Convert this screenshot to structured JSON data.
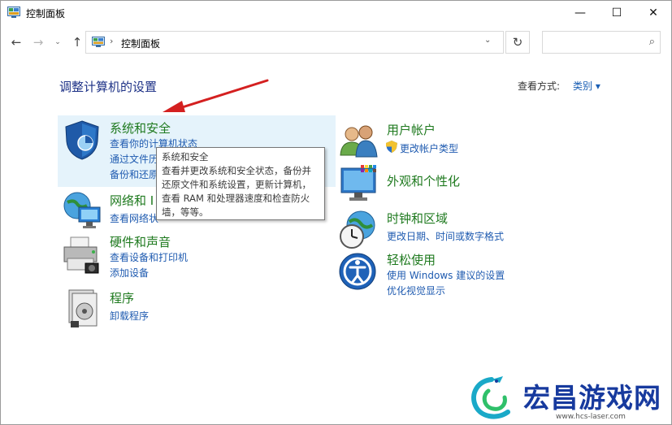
{
  "window": {
    "title": "控制面板",
    "controls": {
      "minimize": "—",
      "maximize": "☐",
      "close": "✕"
    }
  },
  "nav": {
    "back": "←",
    "forward": "→",
    "history_dropdown": "⌄",
    "up": "↑"
  },
  "address": {
    "separator": "›",
    "path": "控制面板",
    "dropdown": "⌄",
    "refresh": "↻"
  },
  "search": {
    "placeholder": "",
    "icon": "⌕"
  },
  "header": {
    "title": "调整计算机的设置",
    "view_by_label": "查看方式:",
    "view_by_value": "类别 ▾"
  },
  "categories": {
    "system_security": {
      "title": "系统和安全",
      "links": [
        "查看你的计算机状态",
        "通过文件历",
        "备份和还原"
      ]
    },
    "network": {
      "title": "网络和 I",
      "links": [
        "查看网络状"
      ]
    },
    "hardware": {
      "title": "硬件和声音",
      "links": [
        "查看设备和打印机",
        "添加设备"
      ]
    },
    "programs": {
      "title": "程序",
      "links": [
        "卸载程序"
      ]
    },
    "user_accounts": {
      "title": "用户帐户",
      "links": [
        "更改帐户类型"
      ]
    },
    "appearance": {
      "title": "外观和个性化",
      "links": []
    },
    "clock_region": {
      "title": "时钟和区域",
      "links": [
        "更改日期、时间或数字格式"
      ]
    },
    "ease_of_access": {
      "title": "轻松使用",
      "links": [
        "使用 Windows 建议的设置",
        "优化视觉显示"
      ]
    }
  },
  "tooltip": {
    "lines": [
      "系统和安全",
      "查看并更改系统和安全状态，备份并",
      "还原文件和系统设置，更新计算机，",
      "查看 RAM 和处理器速度和检查防火",
      "墙，等等。"
    ]
  },
  "watermark": {
    "brand": "宏昌游戏网",
    "url": "www.hcs-laser.com"
  },
  "colors": {
    "heading": "#1e3287",
    "category_title": "#1f7a1f",
    "link": "#1f5bb0",
    "highlight": "#e5f3fb",
    "arrow": "#d42020",
    "watermark": "#173a9e"
  }
}
